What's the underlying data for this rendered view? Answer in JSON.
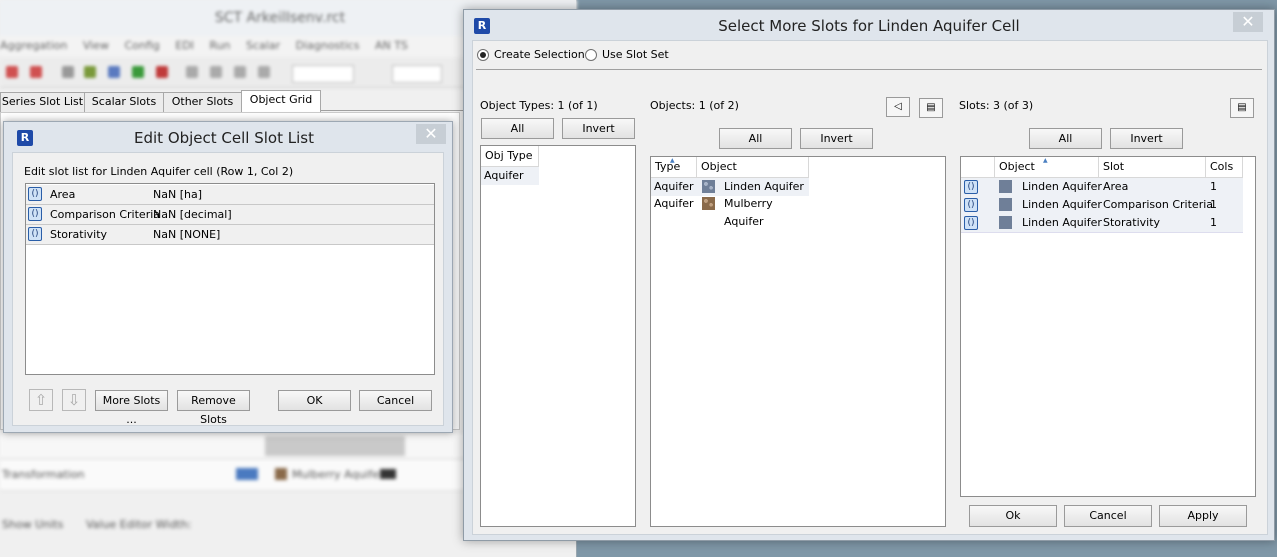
{
  "background_app": {
    "title": "SCT ArkeilIsenv.rct",
    "menu": [
      "Aggregation",
      "View",
      "Config",
      "EDI",
      "Run",
      "Scalar",
      "Diagnostics",
      "AN TS"
    ],
    "tabs": [
      "Series Slot List",
      "Scalar Slots",
      "Other Slots",
      "Object Grid"
    ],
    "active_tab": "Object Grid",
    "row_object": "Mulberry Aquifer",
    "row_label": "Transformation",
    "footer_check": "Show Units",
    "footer_label": "Value Editor Width:"
  },
  "edit_dialog": {
    "title": "Edit Object Cell Slot List",
    "description": "Edit slot list for Linden Aquifer cell (Row 1, Col 2)",
    "slots": [
      {
        "name": "Area",
        "value": "NaN [ha]"
      },
      {
        "name": "Comparison Criteria",
        "value": "NaN [decimal]"
      },
      {
        "name": "Storativity",
        "value": "NaN [NONE]"
      }
    ],
    "buttons": {
      "more_slots": "More Slots ...",
      "remove_slots": "Remove Slots",
      "ok": "OK",
      "cancel": "Cancel"
    },
    "close": "✕"
  },
  "select_dialog": {
    "title": "Select More Slots for Linden Aquifer Cell",
    "close": "✕",
    "radio_create": "Create Selection",
    "radio_use": "Use Slot Set",
    "selected_radio": "create",
    "object_types": {
      "label": "Object Types: 1 (of 1)",
      "all": "All",
      "invert": "Invert",
      "header": "Obj Type",
      "rows": [
        "Aquifer"
      ]
    },
    "objects": {
      "label": "Objects: 1 (of 2)",
      "all": "All",
      "invert": "Invert",
      "headers": {
        "type": "Type",
        "object": "Object"
      },
      "rows": [
        {
          "type": "Aquifer",
          "object": "Linden Aquifer",
          "color": "#6f7f98"
        },
        {
          "type": "Aquifer",
          "object": "Mulberry Aquifer",
          "color": "#8a6a4a"
        }
      ]
    },
    "slots": {
      "label": "Slots: 3 (of 3)",
      "all": "All",
      "invert": "Invert",
      "headers": {
        "object": "Object",
        "slot": "Slot",
        "cols": "Cols"
      },
      "rows": [
        {
          "object": "Linden Aquifer",
          "slot": "Area",
          "cols": "1"
        },
        {
          "object": "Linden Aquifer",
          "slot": "Comparison Criteria",
          "cols": "1"
        },
        {
          "object": "Linden Aquifer",
          "slot": "Storativity",
          "cols": "1"
        }
      ]
    },
    "buttons": {
      "ok": "Ok",
      "cancel": "Cancel",
      "apply": "Apply"
    }
  }
}
